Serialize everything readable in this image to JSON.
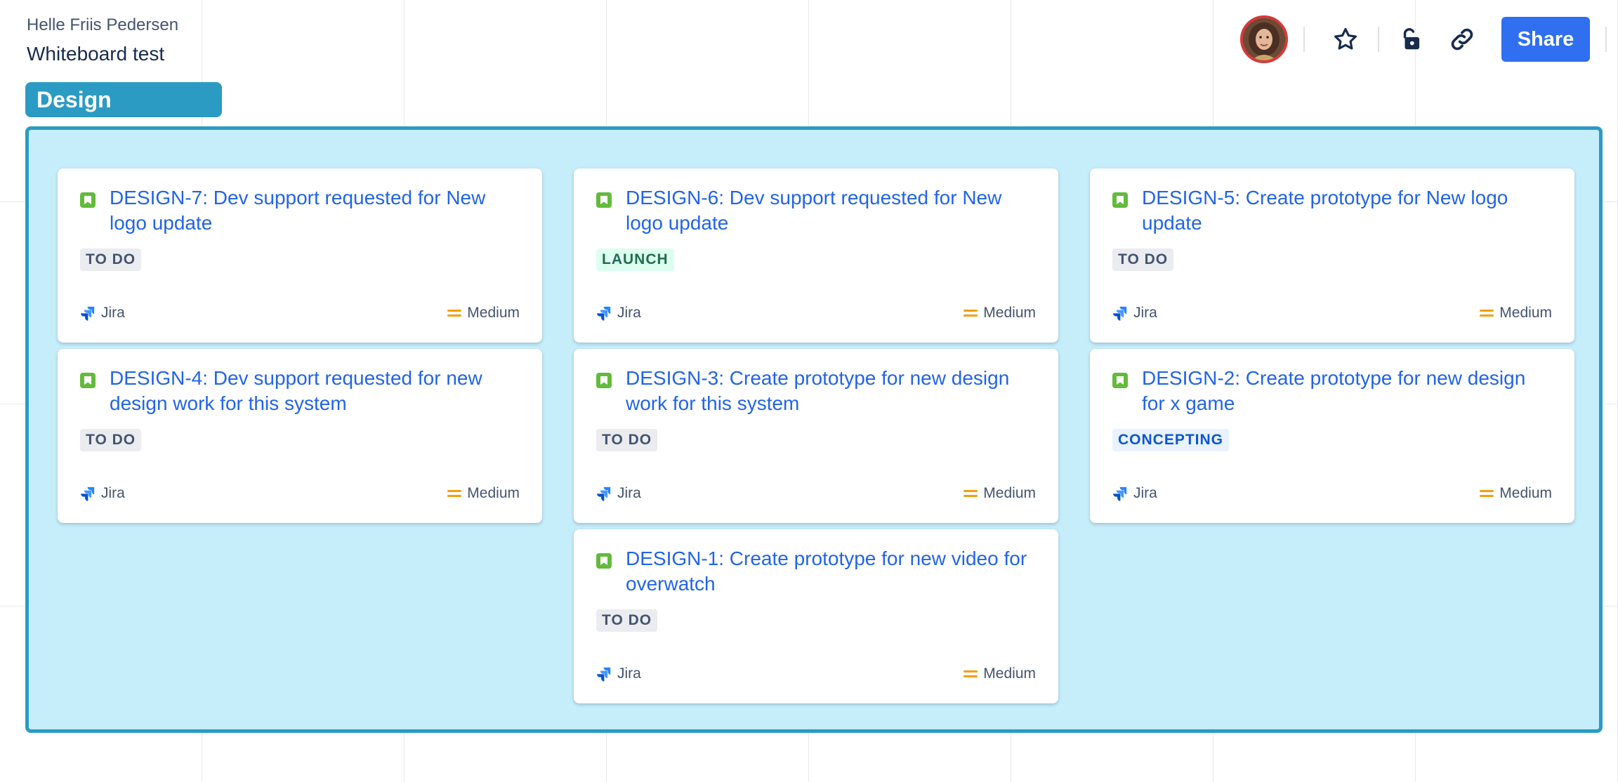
{
  "header": {
    "owner": "Helle Friis Pedersen",
    "board_title": "Whiteboard test"
  },
  "toolbar": {
    "share_label": "Share"
  },
  "frame": {
    "label": "Design",
    "border_color": "#2b9bc3",
    "background_color": "#c6edfa"
  },
  "cards": [
    {
      "title": "DESIGN-7: Dev support requested for New logo update",
      "status": "TO DO",
      "source": "Jira",
      "priority": "Medium"
    },
    {
      "title": "DESIGN-6: Dev support requested for New logo update",
      "status": "LAUNCH",
      "source": "Jira",
      "priority": "Medium"
    },
    {
      "title": "DESIGN-5: Create prototype for New logo update",
      "status": "TO DO",
      "source": "Jira",
      "priority": "Medium"
    },
    {
      "title": "DESIGN-4: Dev support requested for new design work for this system",
      "status": "TO DO",
      "source": "Jira",
      "priority": "Medium"
    },
    {
      "title": "DESIGN-3: Create prototype for new design work for this system",
      "status": "TO DO",
      "source": "Jira",
      "priority": "Medium"
    },
    {
      "title": "DESIGN-2: Create prototype for new design for x game",
      "status": "CONCEPTING",
      "source": "Jira",
      "priority": "Medium"
    },
    {
      "title": "DESIGN-1: Create prototype for new video for overwatch",
      "status": "TO DO",
      "source": "Jira",
      "priority": "Medium"
    }
  ],
  "icons": {
    "toolbar": [
      "avatar",
      "star-icon",
      "unlock-icon",
      "link-icon"
    ],
    "card": [
      "story-icon",
      "jira-icon",
      "priority-medium-icon"
    ]
  },
  "colors": {
    "accent": "#2f6ff0",
    "link": "#2264e6",
    "story": "#63ba3c",
    "priority_medium": "#f59e0b"
  }
}
